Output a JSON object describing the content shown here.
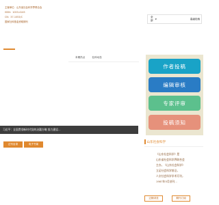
{
  "header": {
    "lines": [
      "主管单位：山东省社会科学界联合会",
      "ISSN：1003-4145",
      "CN：37-1053/C",
      "国家社科基金资助期刊"
    ]
  },
  "search": {
    "select_label": "全部",
    "button_label": "高级检索",
    "placeholder": ""
  },
  "nav": {
    "tabs": [
      "本期热点",
      "社科动态"
    ]
  },
  "right_panel": {
    "buttons": [
      "作者投稿",
      "编辑审核",
      "专家评审",
      "投稿须知"
    ]
  },
  "notice": {
    "text": "习近平：全面贯彻新时代党的治疆方略 努力建设..."
  },
  "left_buttons": [
    "过刊目录",
    "电子书架"
  ],
  "journal": {
    "title": "山东社会科学",
    "desc_lines": [
      "《山东社会科学》是",
      "山东省社会科学界联合会",
      "主办，《山东社会科学》",
      "立足社会科学前沿，",
      "人文社会科学学术月刊，",
      "1987年5月创刊..."
    ]
  },
  "bottom_buttons": [
    "过期浏览",
    "期刊订阅"
  ],
  "colors": {
    "accent": "#e0892f",
    "panel_bg": "#ebe6d0",
    "btn_submit": "#19a3c7",
    "btn_review": "#2a7cc5",
    "btn_expert": "#5cc08d",
    "btn_notice": "#e6917b",
    "notice_bg": "#3d3d3d"
  }
}
